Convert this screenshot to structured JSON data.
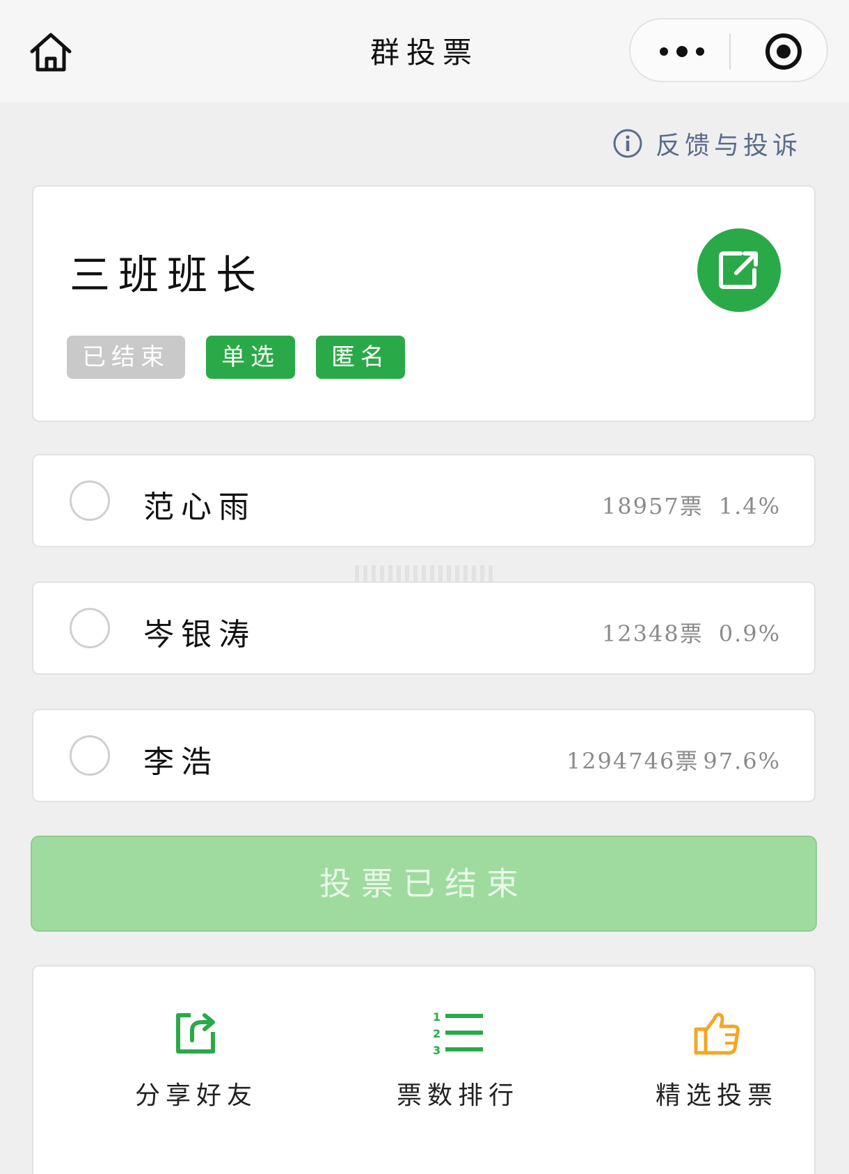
{
  "navbar": {
    "title": "群投票",
    "home_icon": "home-icon",
    "more_icon": "more-dots-icon",
    "close_icon": "target-circle-icon"
  },
  "feedback": {
    "label": "反馈与投诉",
    "icon": "info-icon"
  },
  "vote": {
    "title": "三班班长",
    "share_icon": "share-external-icon",
    "tags": [
      "已结束",
      "单选",
      "匿名"
    ]
  },
  "options": [
    {
      "name": "范心雨",
      "votes": "18957票",
      "percent": "1.4%"
    },
    {
      "name": "岑银涛",
      "votes": "12348票",
      "percent": "0.9%"
    },
    {
      "name": "李浩",
      "votes": "1294746票",
      "percent": "97.6%"
    }
  ],
  "end_button": "投票已结束",
  "actions": [
    {
      "label": "分享好友",
      "icon": "share-friend-icon"
    },
    {
      "label": "票数排行",
      "icon": "ranking-list-icon"
    },
    {
      "label": "精选投票",
      "icon": "thumbs-up-icon"
    }
  ],
  "colors": {
    "green": "#2aa948",
    "disabled_green": "#9fdb9f",
    "orange": "#f5a623",
    "feedback_blue": "#5b6b8c"
  }
}
